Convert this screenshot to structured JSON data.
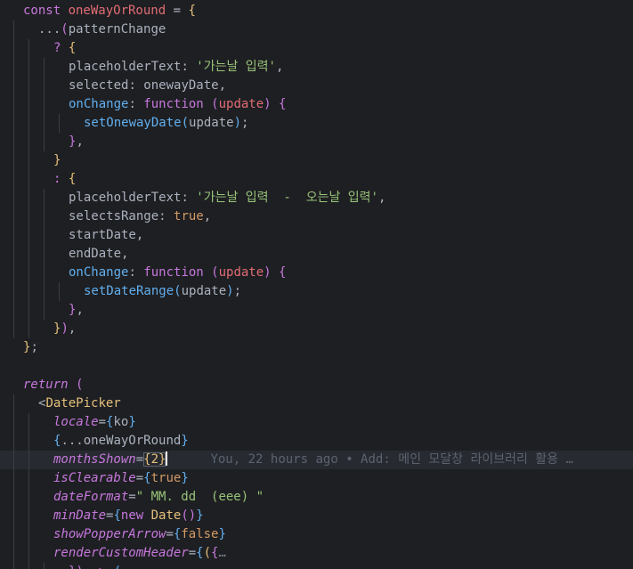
{
  "colors": {
    "background": "#1e1f22",
    "keyword": "#c678dd",
    "variable": "#e06c75",
    "property": "#abb2bf",
    "function": "#61afef",
    "string": "#98c379",
    "boolean": "#d19a66",
    "bracket_gold": "#e5c07b",
    "bracket_purple": "#c678dd",
    "bracket_blue": "#61afef",
    "jsx_tag": "#e5c07b",
    "jsx_attribute": "#c678dd",
    "blame": "#5c6370"
  },
  "editor": {
    "blame_annotation": {
      "author": "You",
      "time": "22 hours ago",
      "separator": "•",
      "message": "Add: 메인 모달창 라이브러리 활용 …"
    },
    "lines": [
      {
        "indent": 1,
        "tokens": [
          {
            "t": "const ",
            "c": "keyword"
          },
          {
            "t": "oneWayOrRound",
            "c": "variable"
          },
          {
            "t": " = ",
            "c": "property"
          },
          {
            "t": "{",
            "c": "bracket_gold"
          }
        ]
      },
      {
        "indent": 2,
        "tokens": [
          {
            "t": "...",
            "c": "property"
          },
          {
            "t": "(",
            "c": "bracket_purple"
          },
          {
            "t": "patternChange",
            "c": "property"
          }
        ]
      },
      {
        "indent": 3,
        "tokens": [
          {
            "t": "? ",
            "c": "keyword"
          },
          {
            "t": "{",
            "c": "bracket_gold"
          }
        ]
      },
      {
        "indent": 4,
        "tokens": [
          {
            "t": "placeholderText",
            "c": "property"
          },
          {
            "t": ": ",
            "c": "property"
          },
          {
            "t": "'가는날 입력'",
            "c": "string"
          },
          {
            "t": ",",
            "c": "property"
          }
        ]
      },
      {
        "indent": 4,
        "tokens": [
          {
            "t": "selected",
            "c": "property"
          },
          {
            "t": ": onewayDate,",
            "c": "property"
          }
        ]
      },
      {
        "indent": 4,
        "tokens": [
          {
            "t": "onChange",
            "c": "function"
          },
          {
            "t": ": ",
            "c": "property"
          },
          {
            "t": "function ",
            "c": "keyword"
          },
          {
            "t": "(",
            "c": "bracket_purple"
          },
          {
            "t": "update",
            "c": "variable"
          },
          {
            "t": ")",
            "c": "bracket_purple"
          },
          {
            "t": " ",
            "c": "property"
          },
          {
            "t": "{",
            "c": "bracket_purple"
          }
        ]
      },
      {
        "indent": 5,
        "tokens": [
          {
            "t": "setOnewayDate",
            "c": "function"
          },
          {
            "t": "(",
            "c": "bracket_blue"
          },
          {
            "t": "update",
            "c": "property"
          },
          {
            "t": ")",
            "c": "bracket_blue"
          },
          {
            "t": ";",
            "c": "property"
          }
        ]
      },
      {
        "indent": 4,
        "tokens": [
          {
            "t": "}",
            "c": "bracket_purple"
          },
          {
            "t": ",",
            "c": "property"
          }
        ]
      },
      {
        "indent": 3,
        "tokens": [
          {
            "t": "}",
            "c": "bracket_gold"
          }
        ]
      },
      {
        "indent": 3,
        "tokens": [
          {
            "t": ": ",
            "c": "keyword"
          },
          {
            "t": "{",
            "c": "bracket_gold"
          }
        ]
      },
      {
        "indent": 4,
        "tokens": [
          {
            "t": "placeholderText",
            "c": "property"
          },
          {
            "t": ": ",
            "c": "property"
          },
          {
            "t": "'가는날 입력  -  오는날 입력'",
            "c": "string"
          },
          {
            "t": ",",
            "c": "property"
          }
        ]
      },
      {
        "indent": 4,
        "tokens": [
          {
            "t": "selectsRange",
            "c": "property"
          },
          {
            "t": ": ",
            "c": "property"
          },
          {
            "t": "true",
            "c": "boolean"
          },
          {
            "t": ",",
            "c": "property"
          }
        ]
      },
      {
        "indent": 4,
        "tokens": [
          {
            "t": "startDate,",
            "c": "property"
          }
        ]
      },
      {
        "indent": 4,
        "tokens": [
          {
            "t": "endDate,",
            "c": "property"
          }
        ]
      },
      {
        "indent": 4,
        "tokens": [
          {
            "t": "onChange",
            "c": "function"
          },
          {
            "t": ": ",
            "c": "property"
          },
          {
            "t": "function ",
            "c": "keyword"
          },
          {
            "t": "(",
            "c": "bracket_purple"
          },
          {
            "t": "update",
            "c": "variable"
          },
          {
            "t": ")",
            "c": "bracket_purple"
          },
          {
            "t": " ",
            "c": "property"
          },
          {
            "t": "{",
            "c": "bracket_purple"
          }
        ]
      },
      {
        "indent": 5,
        "tokens": [
          {
            "t": "setDateRange",
            "c": "function"
          },
          {
            "t": "(",
            "c": "bracket_blue"
          },
          {
            "t": "update",
            "c": "property"
          },
          {
            "t": ")",
            "c": "bracket_blue"
          },
          {
            "t": ";",
            "c": "property"
          }
        ]
      },
      {
        "indent": 4,
        "tokens": [
          {
            "t": "}",
            "c": "bracket_purple"
          },
          {
            "t": ",",
            "c": "property"
          }
        ]
      },
      {
        "indent": 3,
        "tokens": [
          {
            "t": "}",
            "c": "bracket_gold"
          },
          {
            "t": ")",
            "c": "bracket_purple"
          },
          {
            "t": ",",
            "c": "property"
          }
        ]
      },
      {
        "indent": 1,
        "tokens": [
          {
            "t": "}",
            "c": "bracket_gold"
          },
          {
            "t": ";",
            "c": "property"
          }
        ]
      },
      {
        "indent": 0,
        "tokens": []
      },
      {
        "indent": 1,
        "tokens": [
          {
            "t": "return",
            "c": "keyword",
            "italic": true
          },
          {
            "t": " ",
            "c": "property"
          },
          {
            "t": "(",
            "c": "bracket_purple"
          }
        ]
      },
      {
        "indent": 2,
        "tokens": [
          {
            "t": "<",
            "c": "property"
          },
          {
            "t": "DatePicker",
            "c": "jsx_tag"
          }
        ]
      },
      {
        "indent": 3,
        "tokens": [
          {
            "t": "locale",
            "c": "jsx_attribute",
            "italic": true
          },
          {
            "t": "=",
            "c": "property"
          },
          {
            "t": "{",
            "c": "bracket_blue"
          },
          {
            "t": "ko",
            "c": "property"
          },
          {
            "t": "}",
            "c": "bracket_blue"
          }
        ]
      },
      {
        "indent": 3,
        "tokens": [
          {
            "t": "{",
            "c": "bracket_blue"
          },
          {
            "t": "...oneWayOrRound",
            "c": "property"
          },
          {
            "t": "}",
            "c": "bracket_blue"
          }
        ]
      },
      {
        "indent": 3,
        "current": true,
        "cursor_after": 3,
        "blame": true,
        "tokens": [
          {
            "t": "monthsShown",
            "c": "jsx_attribute",
            "italic": true
          },
          {
            "t": "=",
            "c": "property"
          },
          {
            "t": "{2}",
            "c": "bracket_gold",
            "boxed": true
          }
        ]
      },
      {
        "indent": 3,
        "tokens": [
          {
            "t": "isClearable",
            "c": "jsx_attribute",
            "italic": true
          },
          {
            "t": "=",
            "c": "property"
          },
          {
            "t": "{",
            "c": "bracket_blue"
          },
          {
            "t": "true",
            "c": "boolean"
          },
          {
            "t": "}",
            "c": "bracket_blue"
          }
        ]
      },
      {
        "indent": 3,
        "tokens": [
          {
            "t": "dateFormat",
            "c": "jsx_attribute",
            "italic": true
          },
          {
            "t": "=",
            "c": "property"
          },
          {
            "t": "\" MM. dd  (eee) \"",
            "c": "string"
          }
        ]
      },
      {
        "indent": 3,
        "tokens": [
          {
            "t": "minDate",
            "c": "jsx_attribute",
            "italic": true
          },
          {
            "t": "=",
            "c": "property"
          },
          {
            "t": "{",
            "c": "bracket_blue"
          },
          {
            "t": "new ",
            "c": "keyword"
          },
          {
            "t": "Date",
            "c": "jsx_tag"
          },
          {
            "t": "()",
            "c": "bracket_purple"
          },
          {
            "t": "}",
            "c": "bracket_blue"
          }
        ]
      },
      {
        "indent": 3,
        "tokens": [
          {
            "t": "showPopperArrow",
            "c": "jsx_attribute",
            "italic": true
          },
          {
            "t": "=",
            "c": "property"
          },
          {
            "t": "{",
            "c": "bracket_blue"
          },
          {
            "t": "false",
            "c": "boolean"
          },
          {
            "t": "}",
            "c": "bracket_blue"
          }
        ]
      },
      {
        "indent": 3,
        "tokens": [
          {
            "t": "renderCustomHeader",
            "c": "jsx_attribute",
            "italic": true
          },
          {
            "t": "=",
            "c": "property"
          },
          {
            "t": "{",
            "c": "bracket_blue"
          },
          {
            "t": "(",
            "c": "bracket_gold"
          },
          {
            "t": "{",
            "c": "bracket_purple"
          },
          {
            "t": "…",
            "c": "fold"
          }
        ]
      },
      {
        "indent": 4,
        "tokens": [
          {
            "t": "})",
            "c": "bracket_purple"
          },
          {
            "t": " => ",
            "c": "keyword"
          },
          {
            "t": "(",
            "c": "bracket_blue"
          }
        ]
      }
    ]
  }
}
